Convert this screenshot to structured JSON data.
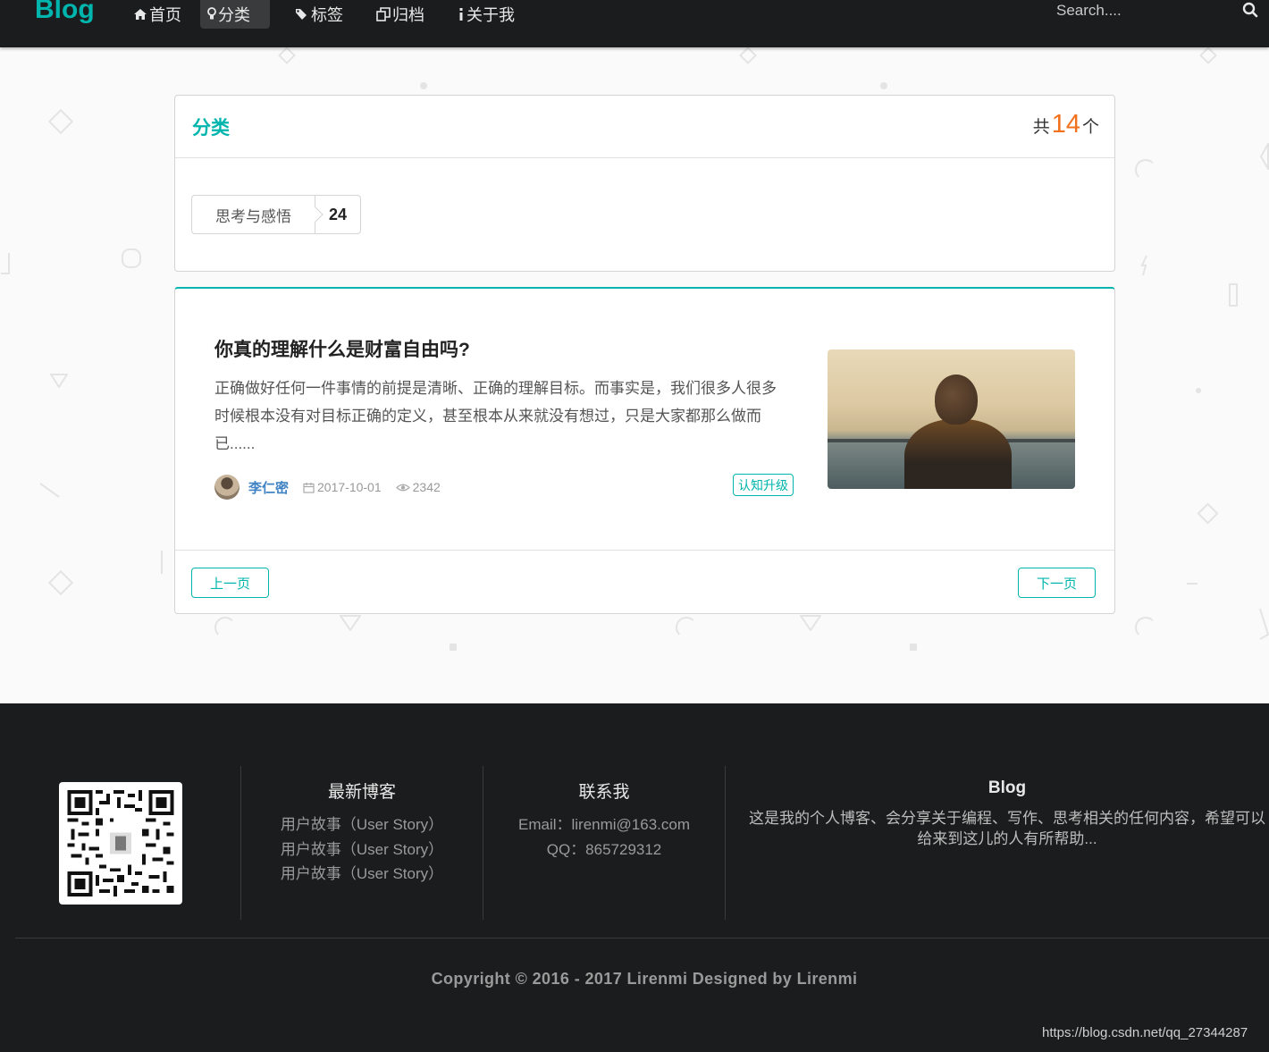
{
  "nav": {
    "brand": "Blog",
    "items": [
      {
        "label": "首页",
        "icon": "home-icon"
      },
      {
        "label": "分类",
        "icon": "idea-icon",
        "active": true
      },
      {
        "label": "标签",
        "icon": "tags-icon"
      },
      {
        "label": "归档",
        "icon": "clone-icon"
      },
      {
        "label": "关于我",
        "icon": "info-icon"
      }
    ],
    "search_placeholder": "Search...."
  },
  "category_panel": {
    "title": "分类",
    "count_prefix": "共",
    "count": "14",
    "count_suffix": "个",
    "categories": [
      {
        "name": "思考与感悟",
        "count": "24"
      }
    ]
  },
  "post": {
    "title": "你真的理解什么是财富自由吗?",
    "excerpt": "正确做好任何一件事情的前提是清晰、正确的理解目标。而事实是，我们很多人很多时候根本没有对目标正确的定义，甚至根本从来就没有想过，只是大家都那么做而已......",
    "author": "李仁密",
    "date": "2017-10-01",
    "views": "2342",
    "tag": "认知升级"
  },
  "pagination": {
    "prev": "上一页",
    "next": "下一页"
  },
  "footer": {
    "col_latest": {
      "title": "最新博客",
      "links": [
        "用户故事（User Story）",
        "用户故事（User Story）",
        "用户故事（User Story）"
      ]
    },
    "col_contact": {
      "title": "联系我",
      "email": "Email：lirenmi@163.com",
      "qq": "QQ：865729312"
    },
    "col_blog": {
      "title": "Blog",
      "text": "这是我的个人博客、会分享关于编程、写作、思考相关的任何内容，希望可以给来到这儿的人有所帮助..."
    },
    "copyright": "Copyright © 2016 - 2017 Lirenmi Designed by Lirenmi",
    "watermark": "https://blog.csdn.net/qq_27344287"
  },
  "colors": {
    "accent": "#00b5ad",
    "count_highlight": "#f2711c",
    "dark_bg": "#1b1c1d",
    "link": "#4183c4"
  }
}
